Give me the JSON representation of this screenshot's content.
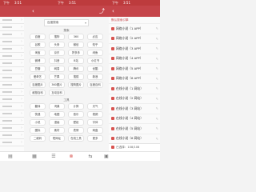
{
  "status": {
    "left_texts": [
      "下午",
      "3:51",
      "下午",
      "3:51",
      "下午",
      "3:51"
    ]
  },
  "panel2": {
    "selector": "百度搜索",
    "section1_title": "搜索",
    "section1_chips": [
      "百度",
      "搜狗",
      "360",
      "必应",
      "谷歌",
      "头条",
      "微信",
      "知乎",
      "淘宝",
      "京东",
      "拼多多",
      "闲鱼",
      "微博",
      "抖音",
      "B站",
      "小红书",
      "豆瓣",
      "网易",
      "腾讯",
      "优酷",
      "爱奇艺",
      "芒果",
      "搜狐",
      "新浪",
      "百度图片",
      "360图片",
      "搜狗图片",
      "百度百科",
      "维基百科",
      "互动百科"
    ],
    "section2_title": "工具",
    "section2_chips": [
      "翻译",
      "词典",
      "计算",
      "天气",
      "快递",
      "地图",
      "音乐",
      "视频",
      "小说",
      "漫画",
      "壁纸",
      "字体",
      "图标",
      "素材",
      "表情",
      "网盘",
      "二维码",
      "短网址",
      "在线工具",
      "更多"
    ]
  },
  "panel3": {
    "header": "默认搜索引擎",
    "items": [
      "网络小说（1 APP）",
      "网络小说（2 APP）",
      "网络小说（3 APP）",
      "网络小说（4 APP）",
      "网络小说（5 APP）",
      "网络小说（6 APP）",
      "在线小说（1 网站）",
      "在线小说（2 网站）",
      "在线小说（3 网站）",
      "在线小说（4 网站）",
      "在线小说（5 网站）",
      "在线小说（6 网站）",
      "在线小说（7 网站）"
    ],
    "footer": "已选择：108/108"
  },
  "icons": {
    "back": "back-arrow-icon",
    "share": "share-icon",
    "more": "more-icon",
    "nav": [
      "book-icon",
      "grid-icon",
      "list-icon",
      "close-circle-icon",
      "swap-icon",
      "tab-icon"
    ]
  },
  "colors": {
    "accent": "#c5454a",
    "check": "#d9534f"
  }
}
